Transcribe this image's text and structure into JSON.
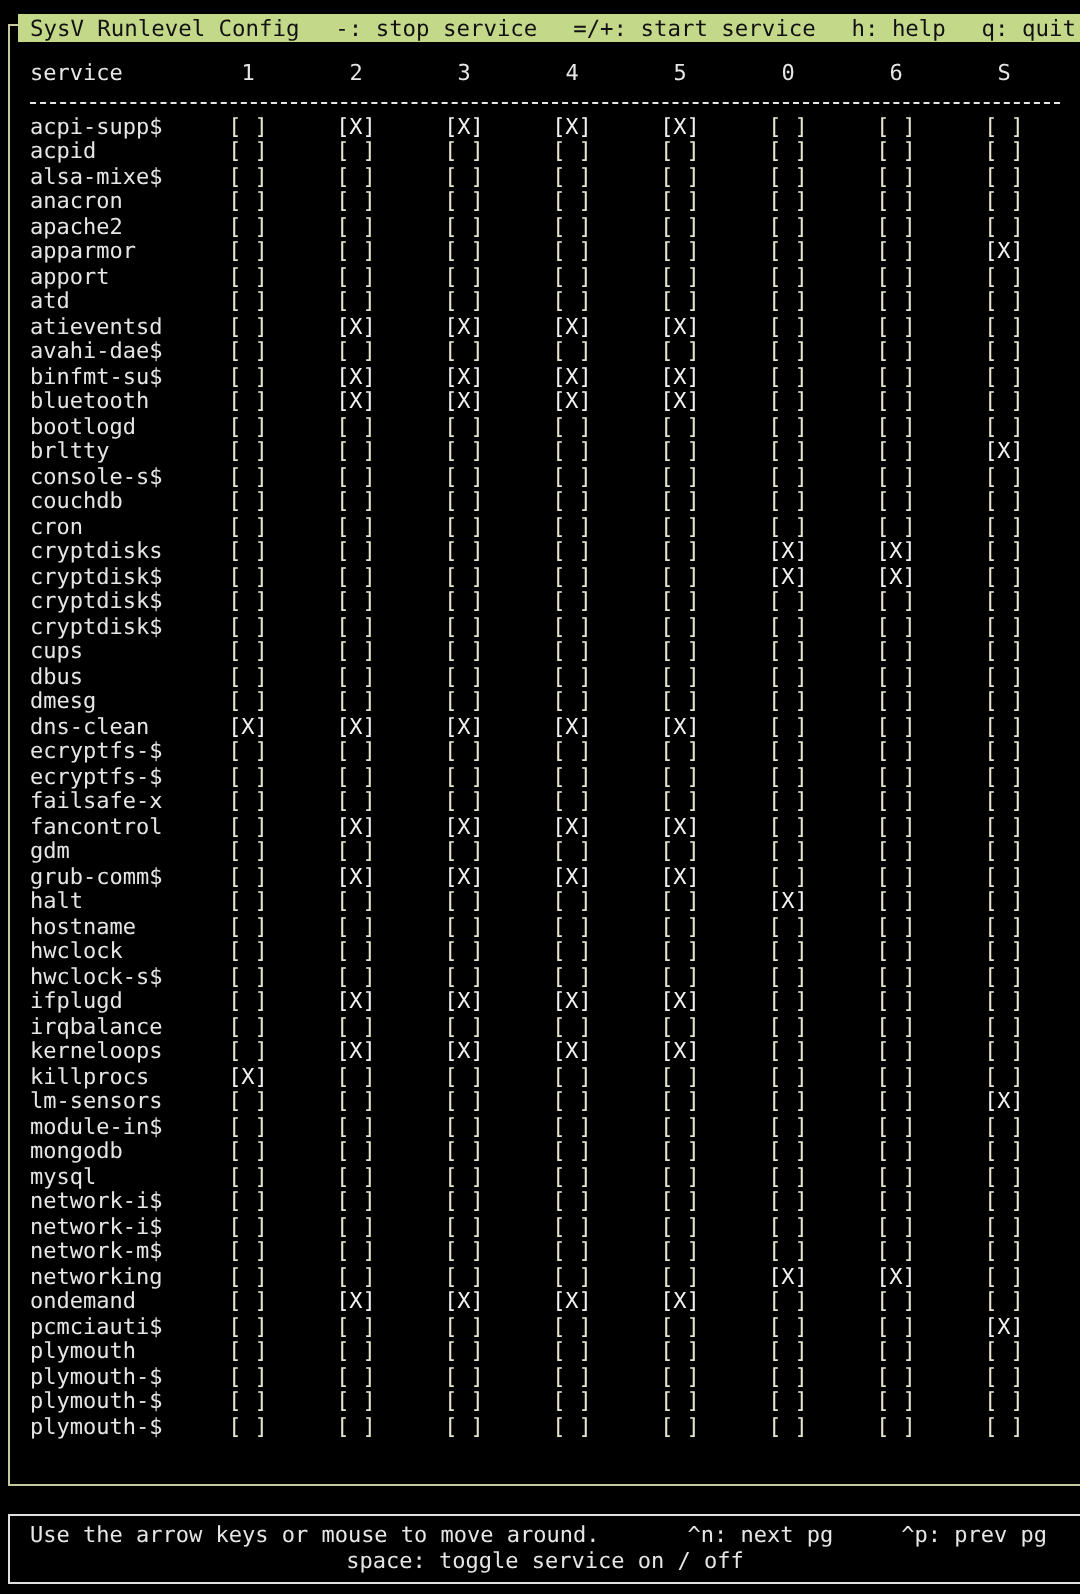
{
  "title_bar": {
    "title": "SysV Runlevel Config",
    "hints": [
      "-: stop service",
      "=/+: start service",
      "h: help",
      "q: quit"
    ]
  },
  "table": {
    "columns": [
      "service",
      "1",
      "2",
      "3",
      "4",
      "5",
      "0",
      "6",
      "S"
    ],
    "rows": [
      {
        "cells": [
          "acpi-supp$",
          "[ ]",
          "[X]",
          "[X]",
          "[X]",
          "[X]",
          "[ ]",
          "[ ]",
          "[ ]"
        ],
        "checked": [
          false,
          true,
          true,
          true,
          true,
          false,
          false,
          false
        ]
      },
      {
        "cells": [
          "acpid",
          "[ ]",
          "[ ]",
          "[ ]",
          "[ ]",
          "[ ]",
          "[ ]",
          "[ ]",
          "[ ]"
        ],
        "checked": [
          false,
          false,
          false,
          false,
          false,
          false,
          false,
          false
        ]
      },
      {
        "cells": [
          "alsa-mixe$",
          "[ ]",
          "[ ]",
          "[ ]",
          "[ ]",
          "[ ]",
          "[ ]",
          "[ ]",
          "[ ]"
        ],
        "checked": [
          false,
          false,
          false,
          false,
          false,
          false,
          false,
          false
        ]
      },
      {
        "cells": [
          "anacron",
          "[ ]",
          "[ ]",
          "[ ]",
          "[ ]",
          "[ ]",
          "[ ]",
          "[ ]",
          "[ ]"
        ],
        "checked": [
          false,
          false,
          false,
          false,
          false,
          false,
          false,
          false
        ]
      },
      {
        "cells": [
          "apache2",
          "[ ]",
          "[ ]",
          "[ ]",
          "[ ]",
          "[ ]",
          "[ ]",
          "[ ]",
          "[ ]"
        ],
        "checked": [
          false,
          false,
          false,
          false,
          false,
          false,
          false,
          false
        ]
      },
      {
        "cells": [
          "apparmor",
          "[ ]",
          "[ ]",
          "[ ]",
          "[ ]",
          "[ ]",
          "[ ]",
          "[ ]",
          "[X]"
        ],
        "checked": [
          false,
          false,
          false,
          false,
          false,
          false,
          false,
          true
        ]
      },
      {
        "cells": [
          "apport",
          "[ ]",
          "[ ]",
          "[ ]",
          "[ ]",
          "[ ]",
          "[ ]",
          "[ ]",
          "[ ]"
        ],
        "checked": [
          false,
          false,
          false,
          false,
          false,
          false,
          false,
          false
        ]
      },
      {
        "cells": [
          "atd",
          "[ ]",
          "[ ]",
          "[ ]",
          "[ ]",
          "[ ]",
          "[ ]",
          "[ ]",
          "[ ]"
        ],
        "checked": [
          false,
          false,
          false,
          false,
          false,
          false,
          false,
          false
        ]
      },
      {
        "cells": [
          "atieventsd",
          "[ ]",
          "[X]",
          "[X]",
          "[X]",
          "[X]",
          "[ ]",
          "[ ]",
          "[ ]"
        ],
        "checked": [
          false,
          true,
          true,
          true,
          true,
          false,
          false,
          false
        ]
      },
      {
        "cells": [
          "avahi-dae$",
          "[ ]",
          "[ ]",
          "[ ]",
          "[ ]",
          "[ ]",
          "[ ]",
          "[ ]",
          "[ ]"
        ],
        "checked": [
          false,
          false,
          false,
          false,
          false,
          false,
          false,
          false
        ]
      },
      {
        "cells": [
          "binfmt-su$",
          "[ ]",
          "[X]",
          "[X]",
          "[X]",
          "[X]",
          "[ ]",
          "[ ]",
          "[ ]"
        ],
        "checked": [
          false,
          true,
          true,
          true,
          true,
          false,
          false,
          false
        ]
      },
      {
        "cells": [
          "bluetooth",
          "[ ]",
          "[X]",
          "[X]",
          "[X]",
          "[X]",
          "[ ]",
          "[ ]",
          "[ ]"
        ],
        "checked": [
          false,
          true,
          true,
          true,
          true,
          false,
          false,
          false
        ]
      },
      {
        "cells": [
          "bootlogd",
          "[ ]",
          "[ ]",
          "[ ]",
          "[ ]",
          "[ ]",
          "[ ]",
          "[ ]",
          "[ ]"
        ],
        "checked": [
          false,
          false,
          false,
          false,
          false,
          false,
          false,
          false
        ]
      },
      {
        "cells": [
          "brltty",
          "[ ]",
          "[ ]",
          "[ ]",
          "[ ]",
          "[ ]",
          "[ ]",
          "[ ]",
          "[X]"
        ],
        "checked": [
          false,
          false,
          false,
          false,
          false,
          false,
          false,
          true
        ]
      },
      {
        "cells": [
          "console-s$",
          "[ ]",
          "[ ]",
          "[ ]",
          "[ ]",
          "[ ]",
          "[ ]",
          "[ ]",
          "[ ]"
        ],
        "checked": [
          false,
          false,
          false,
          false,
          false,
          false,
          false,
          false
        ]
      },
      {
        "cells": [
          "couchdb",
          "[ ]",
          "[ ]",
          "[ ]",
          "[ ]",
          "[ ]",
          "[ ]",
          "[ ]",
          "[ ]"
        ],
        "checked": [
          false,
          false,
          false,
          false,
          false,
          false,
          false,
          false
        ]
      },
      {
        "cells": [
          "cron",
          "[ ]",
          "[ ]",
          "[ ]",
          "[ ]",
          "[ ]",
          "[ ]",
          "[ ]",
          "[ ]"
        ],
        "checked": [
          false,
          false,
          false,
          false,
          false,
          false,
          false,
          false
        ]
      },
      {
        "cells": [
          "cryptdisks",
          "[ ]",
          "[ ]",
          "[ ]",
          "[ ]",
          "[ ]",
          "[X]",
          "[X]",
          "[ ]"
        ],
        "checked": [
          false,
          false,
          false,
          false,
          false,
          true,
          true,
          false
        ]
      },
      {
        "cells": [
          "cryptdisk$",
          "[ ]",
          "[ ]",
          "[ ]",
          "[ ]",
          "[ ]",
          "[X]",
          "[X]",
          "[ ]"
        ],
        "checked": [
          false,
          false,
          false,
          false,
          false,
          true,
          true,
          false
        ]
      },
      {
        "cells": [
          "cryptdisk$",
          "[ ]",
          "[ ]",
          "[ ]",
          "[ ]",
          "[ ]",
          "[ ]",
          "[ ]",
          "[ ]"
        ],
        "checked": [
          false,
          false,
          false,
          false,
          false,
          false,
          false,
          false
        ]
      },
      {
        "cells": [
          "cryptdisk$",
          "[ ]",
          "[ ]",
          "[ ]",
          "[ ]",
          "[ ]",
          "[ ]",
          "[ ]",
          "[ ]"
        ],
        "checked": [
          false,
          false,
          false,
          false,
          false,
          false,
          false,
          false
        ]
      },
      {
        "cells": [
          "cups",
          "[ ]",
          "[ ]",
          "[ ]",
          "[ ]",
          "[ ]",
          "[ ]",
          "[ ]",
          "[ ]"
        ],
        "checked": [
          false,
          false,
          false,
          false,
          false,
          false,
          false,
          false
        ]
      },
      {
        "cells": [
          "dbus",
          "[ ]",
          "[ ]",
          "[ ]",
          "[ ]",
          "[ ]",
          "[ ]",
          "[ ]",
          "[ ]"
        ],
        "checked": [
          false,
          false,
          false,
          false,
          false,
          false,
          false,
          false
        ]
      },
      {
        "cells": [
          "dmesg",
          "[ ]",
          "[ ]",
          "[ ]",
          "[ ]",
          "[ ]",
          "[ ]",
          "[ ]",
          "[ ]"
        ],
        "checked": [
          false,
          false,
          false,
          false,
          false,
          false,
          false,
          false
        ]
      },
      {
        "cells": [
          "dns-clean",
          "[X]",
          "[X]",
          "[X]",
          "[X]",
          "[X]",
          "[ ]",
          "[ ]",
          "[ ]"
        ],
        "checked": [
          true,
          true,
          true,
          true,
          true,
          false,
          false,
          false
        ]
      },
      {
        "cells": [
          "ecryptfs-$",
          "[ ]",
          "[ ]",
          "[ ]",
          "[ ]",
          "[ ]",
          "[ ]",
          "[ ]",
          "[ ]"
        ],
        "checked": [
          false,
          false,
          false,
          false,
          false,
          false,
          false,
          false
        ]
      },
      {
        "cells": [
          "ecryptfs-$",
          "[ ]",
          "[ ]",
          "[ ]",
          "[ ]",
          "[ ]",
          "[ ]",
          "[ ]",
          "[ ]"
        ],
        "checked": [
          false,
          false,
          false,
          false,
          false,
          false,
          false,
          false
        ]
      },
      {
        "cells": [
          "failsafe-x",
          "[ ]",
          "[ ]",
          "[ ]",
          "[ ]",
          "[ ]",
          "[ ]",
          "[ ]",
          "[ ]"
        ],
        "checked": [
          false,
          false,
          false,
          false,
          false,
          false,
          false,
          false
        ]
      },
      {
        "cells": [
          "fancontrol",
          "[ ]",
          "[X]",
          "[X]",
          "[X]",
          "[X]",
          "[ ]",
          "[ ]",
          "[ ]"
        ],
        "checked": [
          false,
          true,
          true,
          true,
          true,
          false,
          false,
          false
        ]
      },
      {
        "cells": [
          "gdm",
          "[ ]",
          "[ ]",
          "[ ]",
          "[ ]",
          "[ ]",
          "[ ]",
          "[ ]",
          "[ ]"
        ],
        "checked": [
          false,
          false,
          false,
          false,
          false,
          false,
          false,
          false
        ]
      },
      {
        "cells": [
          "grub-comm$",
          "[ ]",
          "[X]",
          "[X]",
          "[X]",
          "[X]",
          "[ ]",
          "[ ]",
          "[ ]"
        ],
        "checked": [
          false,
          true,
          true,
          true,
          true,
          false,
          false,
          false
        ]
      },
      {
        "cells": [
          "halt",
          "[ ]",
          "[ ]",
          "[ ]",
          "[ ]",
          "[ ]",
          "[X]",
          "[ ]",
          "[ ]"
        ],
        "checked": [
          false,
          false,
          false,
          false,
          false,
          true,
          false,
          false
        ]
      },
      {
        "cells": [
          "hostname",
          "[ ]",
          "[ ]",
          "[ ]",
          "[ ]",
          "[ ]",
          "[ ]",
          "[ ]",
          "[ ]"
        ],
        "checked": [
          false,
          false,
          false,
          false,
          false,
          false,
          false,
          false
        ]
      },
      {
        "cells": [
          "hwclock",
          "[ ]",
          "[ ]",
          "[ ]",
          "[ ]",
          "[ ]",
          "[ ]",
          "[ ]",
          "[ ]"
        ],
        "checked": [
          false,
          false,
          false,
          false,
          false,
          false,
          false,
          false
        ]
      },
      {
        "cells": [
          "hwclock-s$",
          "[ ]",
          "[ ]",
          "[ ]",
          "[ ]",
          "[ ]",
          "[ ]",
          "[ ]",
          "[ ]"
        ],
        "checked": [
          false,
          false,
          false,
          false,
          false,
          false,
          false,
          false
        ]
      },
      {
        "cells": [
          "ifplugd",
          "[ ]",
          "[X]",
          "[X]",
          "[X]",
          "[X]",
          "[ ]",
          "[ ]",
          "[ ]"
        ],
        "checked": [
          false,
          true,
          true,
          true,
          true,
          false,
          false,
          false
        ]
      },
      {
        "cells": [
          "irqbalance",
          "[ ]",
          "[ ]",
          "[ ]",
          "[ ]",
          "[ ]",
          "[ ]",
          "[ ]",
          "[ ]"
        ],
        "checked": [
          false,
          false,
          false,
          false,
          false,
          false,
          false,
          false
        ]
      },
      {
        "cells": [
          "kerneloops",
          "[ ]",
          "[X]",
          "[X]",
          "[X]",
          "[X]",
          "[ ]",
          "[ ]",
          "[ ]"
        ],
        "checked": [
          false,
          true,
          true,
          true,
          true,
          false,
          false,
          false
        ]
      },
      {
        "cells": [
          "killprocs",
          "[X]",
          "[ ]",
          "[ ]",
          "[ ]",
          "[ ]",
          "[ ]",
          "[ ]",
          "[ ]"
        ],
        "checked": [
          true,
          false,
          false,
          false,
          false,
          false,
          false,
          false
        ]
      },
      {
        "cells": [
          "lm-sensors",
          "[ ]",
          "[ ]",
          "[ ]",
          "[ ]",
          "[ ]",
          "[ ]",
          "[ ]",
          "[X]"
        ],
        "checked": [
          false,
          false,
          false,
          false,
          false,
          false,
          false,
          true
        ]
      },
      {
        "cells": [
          "module-in$",
          "[ ]",
          "[ ]",
          "[ ]",
          "[ ]",
          "[ ]",
          "[ ]",
          "[ ]",
          "[ ]"
        ],
        "checked": [
          false,
          false,
          false,
          false,
          false,
          false,
          false,
          false
        ]
      },
      {
        "cells": [
          "mongodb",
          "[ ]",
          "[ ]",
          "[ ]",
          "[ ]",
          "[ ]",
          "[ ]",
          "[ ]",
          "[ ]"
        ],
        "checked": [
          false,
          false,
          false,
          false,
          false,
          false,
          false,
          false
        ]
      },
      {
        "cells": [
          "mysql",
          "[ ]",
          "[ ]",
          "[ ]",
          "[ ]",
          "[ ]",
          "[ ]",
          "[ ]",
          "[ ]"
        ],
        "checked": [
          false,
          false,
          false,
          false,
          false,
          false,
          false,
          false
        ]
      },
      {
        "cells": [
          "network-i$",
          "[ ]",
          "[ ]",
          "[ ]",
          "[ ]",
          "[ ]",
          "[ ]",
          "[ ]",
          "[ ]"
        ],
        "checked": [
          false,
          false,
          false,
          false,
          false,
          false,
          false,
          false
        ]
      },
      {
        "cells": [
          "network-i$",
          "[ ]",
          "[ ]",
          "[ ]",
          "[ ]",
          "[ ]",
          "[ ]",
          "[ ]",
          "[ ]"
        ],
        "checked": [
          false,
          false,
          false,
          false,
          false,
          false,
          false,
          false
        ]
      },
      {
        "cells": [
          "network-m$",
          "[ ]",
          "[ ]",
          "[ ]",
          "[ ]",
          "[ ]",
          "[ ]",
          "[ ]",
          "[ ]"
        ],
        "checked": [
          false,
          false,
          false,
          false,
          false,
          false,
          false,
          false
        ]
      },
      {
        "cells": [
          "networking",
          "[ ]",
          "[ ]",
          "[ ]",
          "[ ]",
          "[ ]",
          "[X]",
          "[X]",
          "[ ]"
        ],
        "checked": [
          false,
          false,
          false,
          false,
          false,
          true,
          true,
          false
        ]
      },
      {
        "cells": [
          "ondemand",
          "[ ]",
          "[X]",
          "[X]",
          "[X]",
          "[X]",
          "[ ]",
          "[ ]",
          "[ ]"
        ],
        "checked": [
          false,
          true,
          true,
          true,
          true,
          false,
          false,
          false
        ]
      },
      {
        "cells": [
          "pcmciauti$",
          "[ ]",
          "[ ]",
          "[ ]",
          "[ ]",
          "[ ]",
          "[ ]",
          "[ ]",
          "[X]"
        ],
        "checked": [
          false,
          false,
          false,
          false,
          false,
          false,
          false,
          true
        ]
      },
      {
        "cells": [
          "plymouth",
          "[ ]",
          "[ ]",
          "[ ]",
          "[ ]",
          "[ ]",
          "[ ]",
          "[ ]",
          "[ ]"
        ],
        "checked": [
          false,
          false,
          false,
          false,
          false,
          false,
          false,
          false
        ]
      },
      {
        "cells": [
          "plymouth-$",
          "[ ]",
          "[ ]",
          "[ ]",
          "[ ]",
          "[ ]",
          "[ ]",
          "[ ]",
          "[ ]"
        ],
        "checked": [
          false,
          false,
          false,
          false,
          false,
          false,
          false,
          false
        ]
      },
      {
        "cells": [
          "plymouth-$",
          "[ ]",
          "[ ]",
          "[ ]",
          "[ ]",
          "[ ]",
          "[ ]",
          "[ ]",
          "[ ]"
        ],
        "checked": [
          false,
          false,
          false,
          false,
          false,
          false,
          false,
          false
        ]
      },
      {
        "cells": [
          "plymouth-$",
          "[ ]",
          "[ ]",
          "[ ]",
          "[ ]",
          "[ ]",
          "[ ]",
          "[ ]",
          "[ ]"
        ],
        "checked": [
          false,
          false,
          false,
          false,
          false,
          false,
          false,
          false
        ]
      }
    ]
  },
  "help_panel": {
    "line_1": [
      "Use the arrow keys or mouse to move around.",
      "^n: next pg",
      "^p: prev pg"
    ],
    "line_2": "space: toggle service on / off"
  }
}
